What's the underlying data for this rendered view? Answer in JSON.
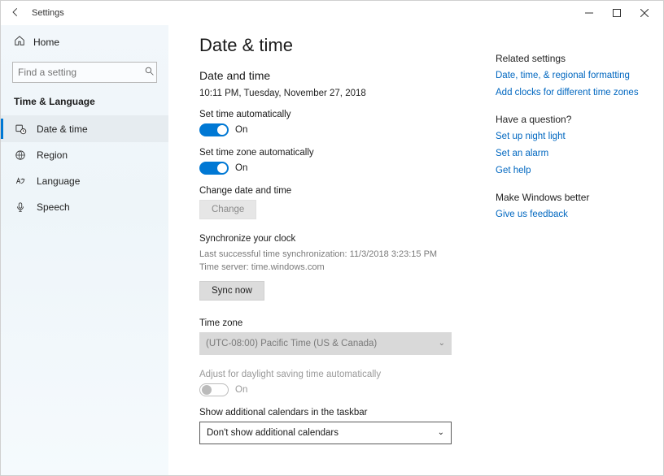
{
  "window": {
    "title": "Settings"
  },
  "sidebar": {
    "home": "Home",
    "search_placeholder": "Find a setting",
    "category": "Time & Language",
    "items": [
      {
        "label": "Date & time"
      },
      {
        "label": "Region"
      },
      {
        "label": "Language"
      },
      {
        "label": "Speech"
      }
    ]
  },
  "page": {
    "h1": "Date & time",
    "h2": "Date and time",
    "timestamp": "10:11 PM, Tuesday, November 27, 2018",
    "set_time_auto_label": "Set time automatically",
    "set_time_auto_state": "On",
    "set_tz_auto_label": "Set time zone automatically",
    "set_tz_auto_state": "On",
    "change_dt_label": "Change date and time",
    "change_btn": "Change",
    "sync_h": "Synchronize your clock",
    "sync_last": "Last successful time synchronization: 11/3/2018 3:23:15 PM",
    "sync_server": "Time server: time.windows.com",
    "sync_btn": "Sync now",
    "tz_h": "Time zone",
    "tz_value": "(UTC-08:00) Pacific Time (US & Canada)",
    "dst_label": "Adjust for daylight saving time automatically",
    "dst_state": "On",
    "addcal_label": "Show additional calendars in the taskbar",
    "addcal_value": "Don't show additional calendars"
  },
  "rail": {
    "related_h": "Related settings",
    "link_formatting": "Date, time, & regional formatting",
    "link_addclocks": "Add clocks for different time zones",
    "question_h": "Have a question?",
    "link_nightlight": "Set up night light",
    "link_alarm": "Set an alarm",
    "link_help": "Get help",
    "better_h": "Make Windows better",
    "link_feedback": "Give us feedback"
  }
}
